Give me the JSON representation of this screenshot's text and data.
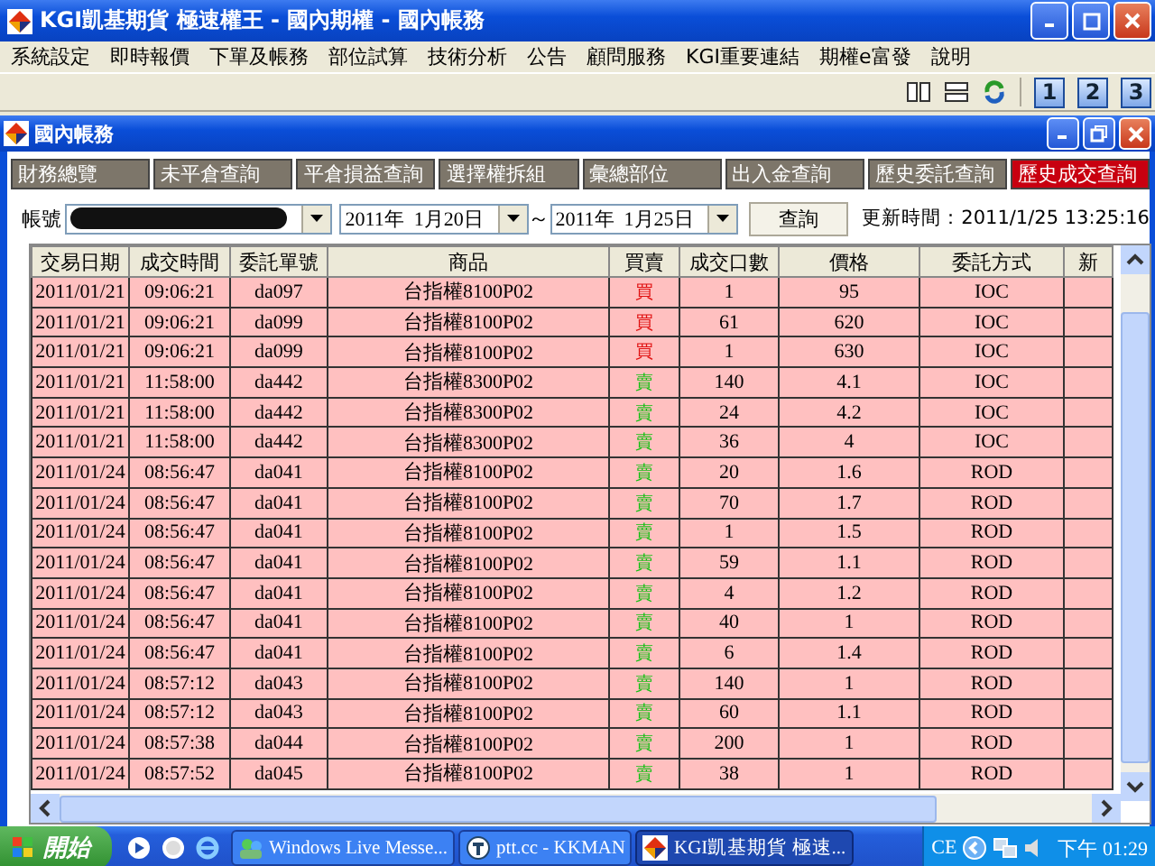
{
  "window": {
    "title": "KGI凱基期貨 極速權王 - 國內期權 - 國內帳務"
  },
  "menu": [
    "系統設定",
    "即時報價",
    "下單及帳務",
    "部位試算",
    "技術分析",
    "公告",
    "顧問服務",
    "KGI重要連結",
    "期權e富發",
    "說明"
  ],
  "toolbar": {
    "layout_buttons": [
      "1",
      "2",
      "3"
    ]
  },
  "child_window": {
    "title": "國內帳務"
  },
  "tabs": [
    {
      "label": "財務總覽",
      "selected": false
    },
    {
      "label": "未平倉查詢",
      "selected": false
    },
    {
      "label": "平倉損益查詢",
      "selected": false
    },
    {
      "label": "選擇權拆組",
      "selected": false
    },
    {
      "label": "彙總部位",
      "selected": false
    },
    {
      "label": "出入金查詢",
      "selected": false
    },
    {
      "label": "歷史委託查詢",
      "selected": false
    },
    {
      "label": "歷史成交查詢",
      "selected": true
    }
  ],
  "filter": {
    "account_label": "帳號",
    "date_from": "2011年  1月20日",
    "separator": "～",
    "date_to": "2011年  1月25日",
    "query_button": "查詢",
    "update_time": "更新時間：2011/1/25 13:25:16"
  },
  "table": {
    "columns": [
      "交易日期",
      "成交時間",
      "委託單號",
      "商品",
      "買賣",
      "成交口數",
      "價格",
      "委託方式",
      "新"
    ],
    "rows": [
      {
        "date": "2011/01/21",
        "time": "09:06:21",
        "order": "da097",
        "product": "台指權8100P02",
        "side": "買",
        "kind": "buy",
        "qty": "1",
        "price": "95",
        "method": "IOC"
      },
      {
        "date": "2011/01/21",
        "time": "09:06:21",
        "order": "da099",
        "product": "台指權8100P02",
        "side": "買",
        "kind": "buy",
        "qty": "61",
        "price": "620",
        "method": "IOC"
      },
      {
        "date": "2011/01/21",
        "time": "09:06:21",
        "order": "da099",
        "product": "台指權8100P02",
        "side": "買",
        "kind": "buy",
        "qty": "1",
        "price": "630",
        "method": "IOC"
      },
      {
        "date": "2011/01/21",
        "time": "11:58:00",
        "order": "da442",
        "product": "台指權8300P02",
        "side": "賣",
        "kind": "sell",
        "qty": "140",
        "price": "4.1",
        "method": "IOC"
      },
      {
        "date": "2011/01/21",
        "time": "11:58:00",
        "order": "da442",
        "product": "台指權8300P02",
        "side": "賣",
        "kind": "sell",
        "qty": "24",
        "price": "4.2",
        "method": "IOC"
      },
      {
        "date": "2011/01/21",
        "time": "11:58:00",
        "order": "da442",
        "product": "台指權8300P02",
        "side": "賣",
        "kind": "sell",
        "qty": "36",
        "price": "4",
        "method": "IOC"
      },
      {
        "date": "2011/01/24",
        "time": "08:56:47",
        "order": "da041",
        "product": "台指權8100P02",
        "side": "賣",
        "kind": "sell",
        "qty": "20",
        "price": "1.6",
        "method": "ROD"
      },
      {
        "date": "2011/01/24",
        "time": "08:56:47",
        "order": "da041",
        "product": "台指權8100P02",
        "side": "賣",
        "kind": "sell",
        "qty": "70",
        "price": "1.7",
        "method": "ROD"
      },
      {
        "date": "2011/01/24",
        "time": "08:56:47",
        "order": "da041",
        "product": "台指權8100P02",
        "side": "賣",
        "kind": "sell",
        "qty": "1",
        "price": "1.5",
        "method": "ROD"
      },
      {
        "date": "2011/01/24",
        "time": "08:56:47",
        "order": "da041",
        "product": "台指權8100P02",
        "side": "賣",
        "kind": "sell",
        "qty": "59",
        "price": "1.1",
        "method": "ROD"
      },
      {
        "date": "2011/01/24",
        "time": "08:56:47",
        "order": "da041",
        "product": "台指權8100P02",
        "side": "賣",
        "kind": "sell",
        "qty": "4",
        "price": "1.2",
        "method": "ROD"
      },
      {
        "date": "2011/01/24",
        "time": "08:56:47",
        "order": "da041",
        "product": "台指權8100P02",
        "side": "賣",
        "kind": "sell",
        "qty": "40",
        "price": "1",
        "method": "ROD"
      },
      {
        "date": "2011/01/24",
        "time": "08:56:47",
        "order": "da041",
        "product": "台指權8100P02",
        "side": "賣",
        "kind": "sell",
        "qty": "6",
        "price": "1.4",
        "method": "ROD"
      },
      {
        "date": "2011/01/24",
        "time": "08:57:12",
        "order": "da043",
        "product": "台指權8100P02",
        "side": "賣",
        "kind": "sell",
        "qty": "140",
        "price": "1",
        "method": "ROD"
      },
      {
        "date": "2011/01/24",
        "time": "08:57:12",
        "order": "da043",
        "product": "台指權8100P02",
        "side": "賣",
        "kind": "sell",
        "qty": "60",
        "price": "1.1",
        "method": "ROD"
      },
      {
        "date": "2011/01/24",
        "time": "08:57:38",
        "order": "da044",
        "product": "台指權8100P02",
        "side": "賣",
        "kind": "sell",
        "qty": "200",
        "price": "1",
        "method": "ROD"
      },
      {
        "date": "2011/01/24",
        "time": "08:57:52",
        "order": "da045",
        "product": "台指權8100P02",
        "side": "賣",
        "kind": "sell",
        "qty": "38",
        "price": "1",
        "method": "ROD"
      }
    ]
  },
  "taskbar": {
    "start": "開始",
    "tasks": [
      {
        "label": "Windows Live Messe...",
        "selected": false
      },
      {
        "label": "ptt.cc - KKMAN",
        "selected": false
      },
      {
        "label": "KGI凱基期貨 極速...",
        "selected": true
      }
    ],
    "language": "CE",
    "clock": "下午 01:29"
  }
}
